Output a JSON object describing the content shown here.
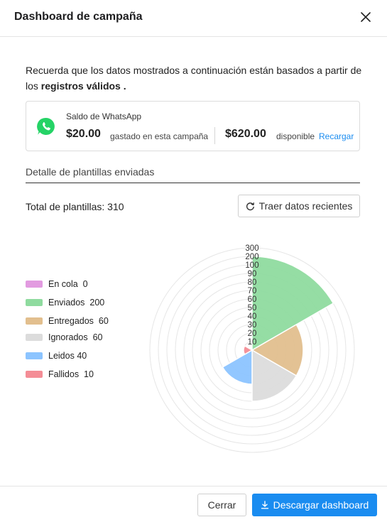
{
  "header": {
    "title": "Dashboard de campaña",
    "close_icon": "close-icon"
  },
  "notice": {
    "text": "Recuerda que los datos mostrados a continuación están basados a partir de los ",
    "bold": "registros válidos",
    "suffix": " ."
  },
  "whatsapp": {
    "title": "Saldo de WhatsApp",
    "spent_amount": "$20.00",
    "spent_label": "gastado en esta campaña",
    "available_amount": "$620.00",
    "available_label": "disponible",
    "recharge_link": "Recargar",
    "icon": "whatsapp-icon",
    "brand_color": "#25d366"
  },
  "section": {
    "title": "Detalle de plantillas enviadas",
    "total_label": "Total de plantillas: 310",
    "refresh_button": "Traer datos recientes",
    "refresh_icon": "refresh-icon"
  },
  "chart_data": {
    "type": "polar-area",
    "scale": "log",
    "radial_ticks": [
      "300",
      "200",
      "100",
      "90",
      "80",
      "70",
      "60",
      "50",
      "40",
      "30",
      "20",
      "10"
    ],
    "series": [
      {
        "name": "En cola",
        "value": 0,
        "color": "#e29be0"
      },
      {
        "name": "Enviados",
        "value": 200,
        "color": "#8fdb9f"
      },
      {
        "name": "Entregados",
        "value": 60,
        "color": "#e2bf8e"
      },
      {
        "name": "Ignorados",
        "value": 60,
        "color": "#dcdcdc"
      },
      {
        "name": "Leidos",
        "value": 40,
        "color": "#8cc4ff"
      },
      {
        "name": "Fallidos",
        "value": 10,
        "color": "#f48d96"
      }
    ],
    "legend_position": "left"
  },
  "footer": {
    "close_button": "Cerrar",
    "download_button": "Descargar dashboard",
    "download_icon": "download-icon",
    "accent_color": "#1a8cf0"
  }
}
